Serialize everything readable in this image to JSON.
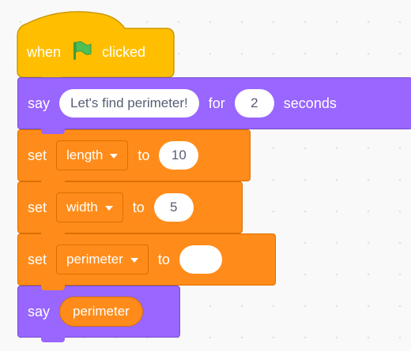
{
  "script": {
    "hat": {
      "label_start": "when",
      "label_end": "clicked",
      "icon": "green-flag-icon"
    },
    "say_for": {
      "say_label": "say",
      "message": "Let's find perimeter!",
      "for_label": "for",
      "secs": "2",
      "seconds_label": "seconds"
    },
    "set_length": {
      "set_label": "set",
      "variable": "length",
      "to_label": "to",
      "value": "10"
    },
    "set_width": {
      "set_label": "set",
      "variable": "width",
      "to_label": "to",
      "value": "5"
    },
    "set_perimeter": {
      "set_label": "set",
      "variable": "perimeter",
      "to_label": "to",
      "value": ""
    },
    "say": {
      "say_label": "say",
      "reporter": "perimeter"
    }
  },
  "colors": {
    "events": "#ffbf00",
    "looks": "#9966ff",
    "variables": "#ff8c1a",
    "flag_green": "#4cbf56",
    "workspace": "#f9f9f9"
  }
}
